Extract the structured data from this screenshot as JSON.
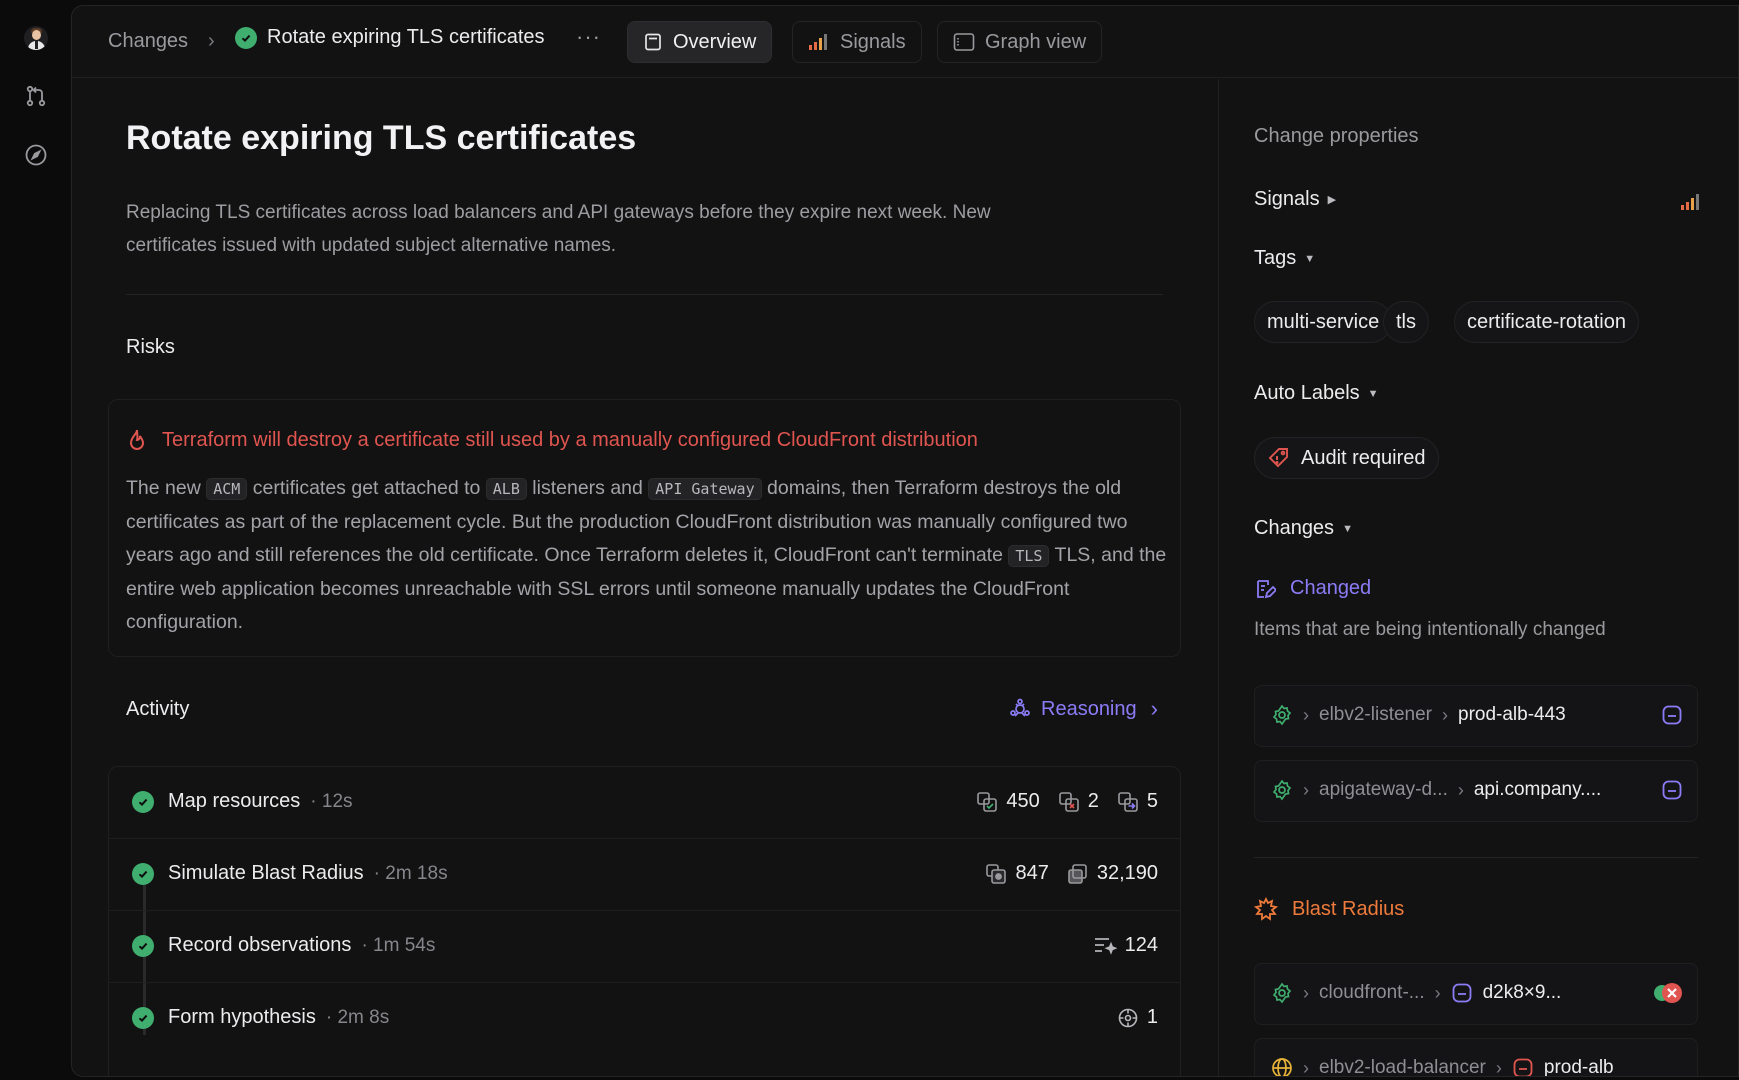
{
  "nav": {
    "breadcrumb_root": "Changes",
    "breadcrumb_sep": "›",
    "breadcrumb_current": "Rotate expiring TLS certificates",
    "more": "···",
    "tabs": [
      {
        "label": "Overview",
        "icon": "overview-icon",
        "active": true
      },
      {
        "label": "Signals",
        "icon": "signal-bars-icon",
        "active": false
      },
      {
        "label": "Graph view",
        "icon": "graph-icon",
        "active": false
      }
    ]
  },
  "main": {
    "title": "Rotate expiring TLS certificates",
    "description": "Replacing TLS certificates across load balancers and API gateways before they expire next week. New certificates issued with updated subject alternative names.",
    "risks_label": "Risks",
    "risk": {
      "title": "Terraform will destroy a certificate still used by a manually configured CloudFront distribution",
      "body": [
        {
          "t": "text",
          "v": "The new "
        },
        {
          "t": "code",
          "v": "ACM"
        },
        {
          "t": "text",
          "v": " certificates get attached to "
        },
        {
          "t": "code",
          "v": "ALB"
        },
        {
          "t": "text",
          "v": " listeners and "
        },
        {
          "t": "code",
          "v": "API Gateway"
        },
        {
          "t": "text",
          "v": " domains, then Terraform destroys the old certificates as part of the replacement cycle. But the production CloudFront distribution was manually configured two years ago and still references the old certificate. Once Terraform deletes it, CloudFront can't terminate "
        },
        {
          "t": "code",
          "v": "TLS"
        },
        {
          "t": "text",
          "v": " TLS, and the entire web application becomes unreachable with SSL errors until someone manually updates the CloudFront configuration."
        }
      ]
    },
    "activity_label": "Activity",
    "reasoning_label": "Reasoning",
    "activity": [
      {
        "name": "Map resources",
        "duration": "· 12s",
        "stats": [
          {
            "icon": "resources-icon",
            "value": "450"
          },
          {
            "icon": "resources-removed-icon",
            "value": "2"
          },
          {
            "icon": "resources-changed-icon",
            "value": "5"
          }
        ]
      },
      {
        "name": "Simulate Blast Radius",
        "duration": "· 2m 18s",
        "stats": [
          {
            "icon": "blast-items-icon",
            "value": "847"
          },
          {
            "icon": "edges-icon",
            "value": "32,190"
          }
        ]
      },
      {
        "name": "Record observations",
        "duration": "· 1m 54s",
        "stats": [
          {
            "icon": "observations-icon",
            "value": "124"
          }
        ]
      },
      {
        "name": "Form hypothesis",
        "duration": "· 2m 8s",
        "stats": [
          {
            "icon": "hypothesis-icon",
            "value": "1"
          }
        ]
      }
    ]
  },
  "sidebar": {
    "heading": "Change properties",
    "signals_label": "Signals",
    "tags_label": "Tags",
    "tags": [
      "multi-service",
      "tls",
      "certificate-rotation"
    ],
    "auto_labels_label": "Auto Labels",
    "auto_label": "Audit required",
    "changes_label": "Changes",
    "changed_label": "Changed",
    "changed_desc": "Items that are being intentionally changed",
    "changed_items": [
      {
        "type": "elbv2-listener",
        "name": "prod-alb-443"
      },
      {
        "type": "apigateway-d...",
        "name": "api.company...."
      }
    ],
    "blast_label": "Blast Radius",
    "blast_items": [
      {
        "type": "cloudfront-...",
        "name": "d2k8×9..."
      },
      {
        "type": "elbv2-load-balancer",
        "name": "prod-alb"
      }
    ]
  },
  "colors": {
    "accent_purple": "#8b7cf6",
    "risk_red": "#e0554f",
    "success_green": "#3fae6f",
    "blast_orange": "#ee7b3b"
  }
}
